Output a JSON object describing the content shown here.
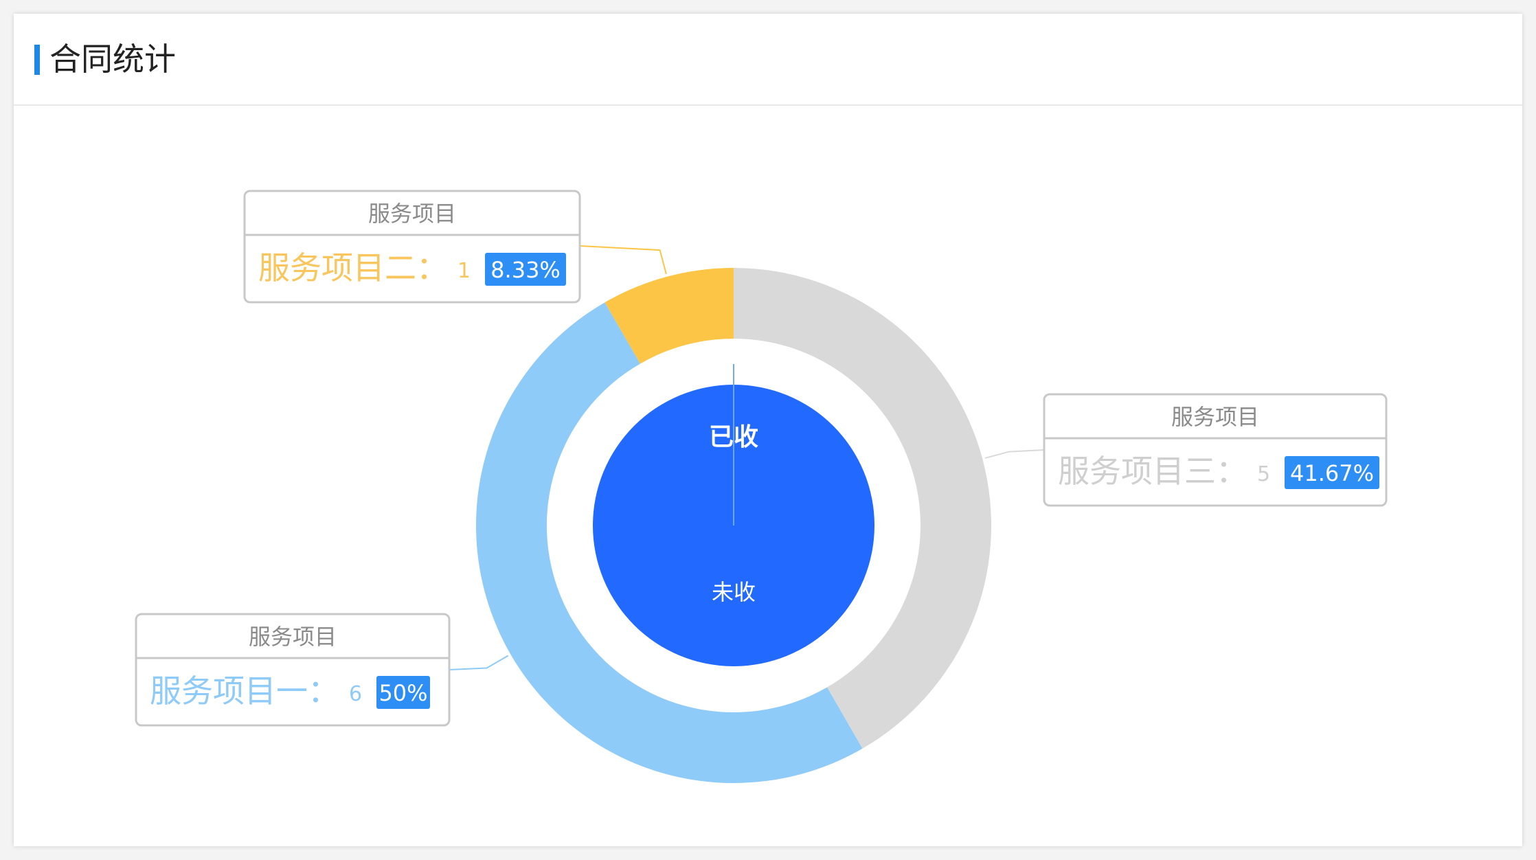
{
  "panel": {
    "title": "合同统计"
  },
  "chart_data": {
    "type": "pie",
    "variant": "nested-donut",
    "outer_ring": {
      "tooltip_title": "服务项目",
      "slices": [
        {
          "name": "服务项目一",
          "value": 6,
          "percent": "50%",
          "color": "#8ecbf8",
          "label_color": "#8ecbf8"
        },
        {
          "name": "服务项目二",
          "value": 1,
          "percent": "8.33%",
          "color": "#fcc545",
          "label_color": "#f8c65c"
        },
        {
          "name": "服务项目三",
          "value": 5,
          "percent": "41.67%",
          "color": "#d9d9d9",
          "label_color": "#cfcfcf"
        }
      ],
      "badge_color": "#2d8ff5"
    },
    "inner_pie": {
      "slices": [
        {
          "name": "已收",
          "value": 0,
          "color": "#2169ff"
        },
        {
          "name": "未收",
          "value": 1,
          "color": "#2169ff"
        }
      ],
      "label_color": "#ffffff"
    },
    "label_separator": "：",
    "grid": false,
    "legend": "none"
  }
}
